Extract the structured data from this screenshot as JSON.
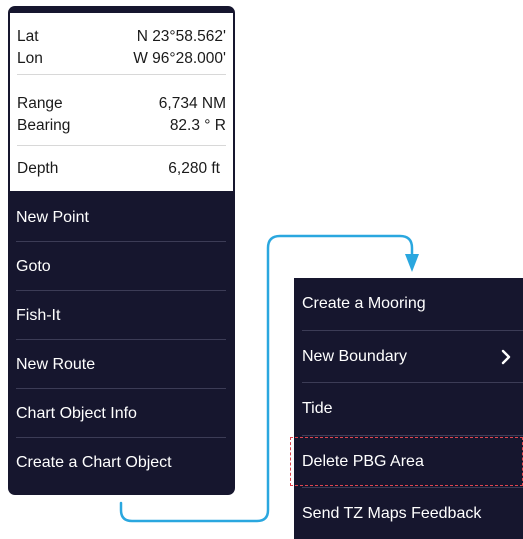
{
  "position_panel": {
    "lat_label": "Lat",
    "lat_value": "N 23°58.562'",
    "lon_label": "Lon",
    "lon_value": "W 96°28.000'",
    "range_label": "Range",
    "range_value": "6,734 NM",
    "bearing_label": "Bearing",
    "bearing_value": "82.3 ° R",
    "depth_label": "Depth",
    "depth_value": "6,280 ft"
  },
  "context_menu": {
    "items": [
      {
        "label": "New Point"
      },
      {
        "label": "Goto"
      },
      {
        "label": "Fish-It"
      },
      {
        "label": "New Route"
      },
      {
        "label": "Chart Object Info"
      },
      {
        "label": "Create a Chart Object"
      }
    ]
  },
  "submenu": {
    "items": [
      {
        "label": "Create a Mooring"
      },
      {
        "label": "New Boundary",
        "icon": "chevron-right-icon"
      },
      {
        "label": "Tide"
      },
      {
        "label": "Delete PBG Area",
        "highlighted": true
      },
      {
        "label": "Send TZ Maps Feedback"
      }
    ]
  },
  "colors": {
    "menu_background": "#16162e",
    "panel_background": "#ffffff",
    "connector": "#2aa7df",
    "highlight": "#e0454f"
  }
}
